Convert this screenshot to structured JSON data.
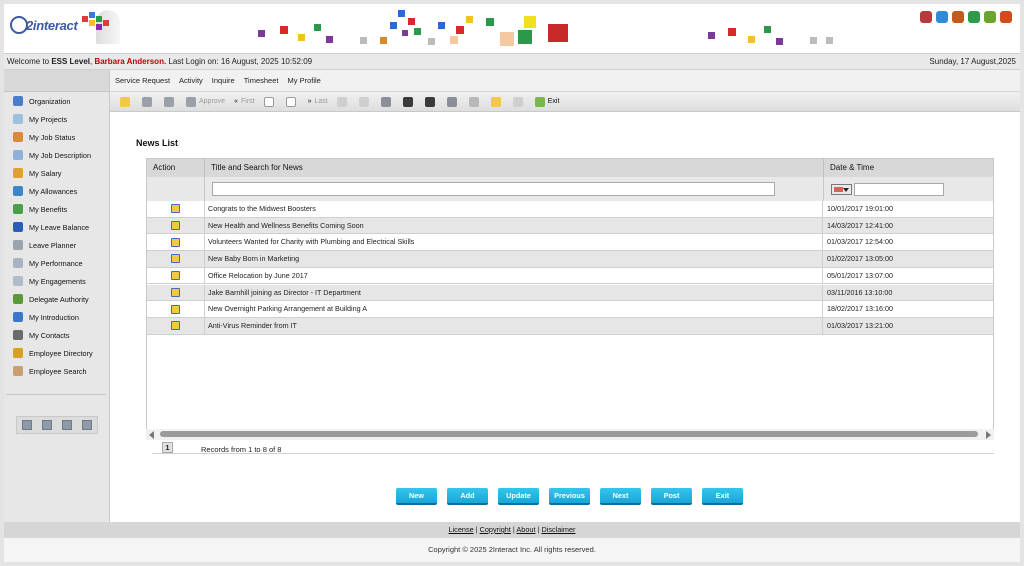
{
  "header": {
    "logo_text": "2interact",
    "icon_colors": [
      "#b63a3a",
      "#2f8bd6",
      "#c15a1a",
      "#2f9a4a",
      "#6aa52e",
      "#d54a1a"
    ]
  },
  "welcome": {
    "prefix": "Welcome to ",
    "level": "ESS Level",
    "comma": ", ",
    "user": "Barbara Anderson.",
    "last_login": " Last Login on: 16 August, 2025 10:52:09",
    "date": "Sunday, 17 August,2025"
  },
  "menu": [
    "Service Request",
    "Activity",
    "Inquire",
    "Timesheet",
    "My Profile"
  ],
  "sidebar": [
    {
      "label": "Organization",
      "icon": "organization-icon",
      "color": "#4a7ec8"
    },
    {
      "label": "My Projects",
      "icon": "projects-icon",
      "color": "#9bc1e0"
    },
    {
      "label": "My Job Status",
      "icon": "job-status-icon",
      "color": "#d88a3a"
    },
    {
      "label": "My Job Description",
      "icon": "job-description-icon",
      "color": "#8fb0d8"
    },
    {
      "label": "My Salary",
      "icon": "salary-icon",
      "color": "#e0a12a"
    },
    {
      "label": "My Allowances",
      "icon": "allowances-icon",
      "color": "#3a86c8"
    },
    {
      "label": "My Benefits",
      "icon": "benefits-icon",
      "color": "#4aa04a"
    },
    {
      "label": "My Leave Balance",
      "icon": "leave-balance-icon",
      "color": "#2a5fb8"
    },
    {
      "label": "Leave Planner",
      "icon": "leave-planner-icon",
      "color": "#9aa4ae"
    },
    {
      "label": "My Performance",
      "icon": "performance-icon",
      "color": "#a8b4c4"
    },
    {
      "label": "My Engagements",
      "icon": "engagements-icon",
      "color": "#b0bccc"
    },
    {
      "label": "Delegate Authority",
      "icon": "delegate-icon",
      "color": "#5a9a3a"
    },
    {
      "label": "My Introduction",
      "icon": "introduction-icon",
      "color": "#3a78c8"
    },
    {
      "label": "My Contacts",
      "icon": "contacts-icon",
      "color": "#6a6a6a"
    },
    {
      "label": "Employee Directory",
      "icon": "directory-icon",
      "color": "#d8a02a"
    },
    {
      "label": "Employee Search",
      "icon": "search-icon",
      "color": "#c8a070"
    }
  ],
  "toolbar": {
    "approve": "Approve",
    "first": "First",
    "last": "Last",
    "exit": "Exit"
  },
  "news": {
    "title": "News List",
    "col_action": "Action",
    "col_title": "Title and Search for News",
    "col_date": "Date & Time",
    "rows": [
      {
        "title": "Congrats to the Midwest Boosters",
        "date": "10/01/2017 19:01:00"
      },
      {
        "title": "New Health and Wellness Benefits Coming Soon",
        "date": "14/03/2017 12:41:00"
      },
      {
        "title": "Volunteers Wanted for Charity with Plumbing and Electrical Skills",
        "date": "01/03/2017 12:54:00"
      },
      {
        "title": "New Baby Born in Marketing",
        "date": "01/02/2017 13:05:00"
      },
      {
        "title": "Office Relocation by June 2017",
        "date": "05/01/2017 13:07:00"
      },
      {
        "title": "Jake Barnhill joining as Director - IT Department",
        "date": "03/11/2016 13:10:00"
      },
      {
        "title": "New Overnight Parking Arrangement at Building A",
        "date": "18/02/2017 13:16:00"
      },
      {
        "title": "Anti-Virus Reminder from IT",
        "date": "01/03/2017 13:21:00"
      }
    ],
    "page": "1",
    "records": "Records from 1 to 8 of 8"
  },
  "buttons": [
    "New",
    "Add",
    "Update",
    "Previous",
    "Next",
    "Post",
    "Exit"
  ],
  "footer": {
    "license": "License",
    "copyright_link": "Copyright",
    "about": "About",
    "disclaimer": "Disclaimer",
    "copyright": "Copyright © 2025 2Interact Inc. All rights reserved."
  }
}
